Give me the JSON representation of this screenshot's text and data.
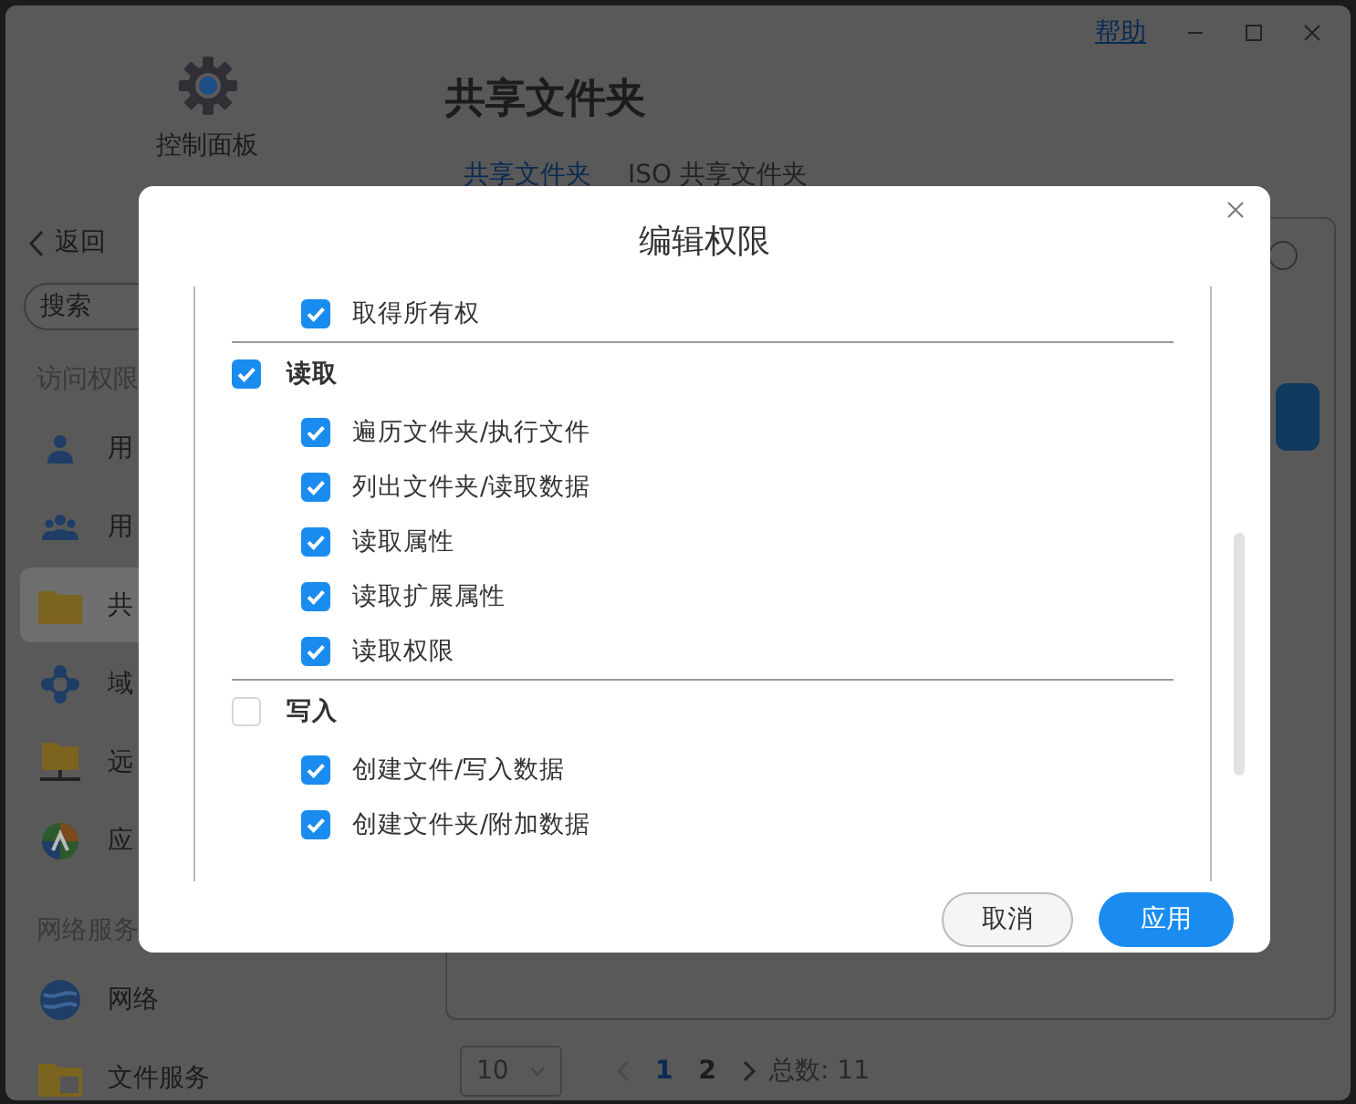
{
  "app": {
    "title": "控制面板",
    "help": "帮助"
  },
  "sidebar": {
    "back": "返回",
    "search_placeholder": "搜索",
    "sections": [
      {
        "title": "访问权限",
        "items": [
          {
            "label": "用",
            "selected": false
          },
          {
            "label": "用",
            "selected": false
          },
          {
            "label": "共",
            "selected": true
          },
          {
            "label": "域",
            "selected": false
          },
          {
            "label": "远",
            "selected": false
          },
          {
            "label": "应",
            "selected": false
          }
        ]
      },
      {
        "title": "网络服务",
        "items": [
          {
            "label": "网络",
            "selected": false
          },
          {
            "label": "文件服务",
            "selected": false
          }
        ]
      }
    ]
  },
  "main": {
    "title": "共享文件夹",
    "tabs": [
      {
        "label": "共享文件夹",
        "selected": true
      },
      {
        "label": "ISO 共享文件夹",
        "selected": false
      }
    ],
    "pagination": {
      "page_size": "10",
      "pages": [
        {
          "label": "1",
          "selected": true
        },
        {
          "label": "2",
          "selected": false
        }
      ],
      "total": "总数: 11"
    }
  },
  "dialog": {
    "title": "编辑权限",
    "permissions": [
      {
        "kind": "item",
        "label": "取得所有权",
        "checked": true
      },
      {
        "kind": "group",
        "label": "读取",
        "checked": true
      },
      {
        "kind": "item",
        "label": "遍历文件夹/执行文件",
        "checked": true
      },
      {
        "kind": "item",
        "label": "列出文件夹/读取数据",
        "checked": true
      },
      {
        "kind": "item",
        "label": "读取属性",
        "checked": true
      },
      {
        "kind": "item",
        "label": "读取扩展属性",
        "checked": true
      },
      {
        "kind": "item",
        "label": "读取权限",
        "checked": true
      },
      {
        "kind": "group",
        "label": "写入",
        "checked": false
      },
      {
        "kind": "item",
        "label": "创建文件/写入数据",
        "checked": true
      },
      {
        "kind": "item",
        "label": "创建文件夹/附加数据",
        "checked": true
      }
    ],
    "buttons": [
      {
        "kind": "secondary",
        "label": "取消"
      },
      {
        "kind": "primary",
        "label": "应用"
      }
    ]
  }
}
